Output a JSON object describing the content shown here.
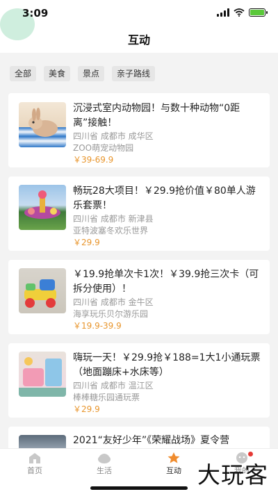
{
  "status_bar": {
    "time": "3:09"
  },
  "header": {
    "title": "互动"
  },
  "filters": [
    "全部",
    "美食",
    "景点",
    "亲子路线"
  ],
  "cards": [
    {
      "title": "沉浸式室内动物园！与数十种动物“0距离”接触！",
      "location": "四川省 成都市 成华区",
      "venue": "ZOO萌宠动物园",
      "price": "￥39-69.9"
    },
    {
      "title": "畅玩28大项目！￥29.9抢价值￥80单人游乐套票！",
      "location": "四川省 成都市 新津县",
      "venue": "亚特波塞冬欢乐世界",
      "price": "￥29.9"
    },
    {
      "title": "￥19.9抢单次卡1次！￥39.9抢三次卡（可拆分使用）！",
      "location": "四川省 成都市 金牛区",
      "venue": "海享玩乐贝尔游乐园",
      "price": "￥19.9-39.9"
    },
    {
      "title": "嗨玩一天！￥29.9抢￥188=1大1小通玩票（地面蹦床+水床等）",
      "location": "四川省 成都市 温江区",
      "venue": "棒棒糖乐园通玩票",
      "price": "￥29.9"
    },
    {
      "title": "2021“友好少年”《荣耀战场》夏令营"
    }
  ],
  "tabs": [
    {
      "label": "首页",
      "icon": "home-icon"
    },
    {
      "label": "生活",
      "icon": "life-icon"
    },
    {
      "label": "互动",
      "icon": "star-icon",
      "active": true
    },
    {
      "label": "我的",
      "icon": "profile-icon"
    }
  ],
  "watermark": "大玩客",
  "colors": {
    "accent": "#f08c2e",
    "price": "#e8952c",
    "background": "#f3f3f3"
  }
}
